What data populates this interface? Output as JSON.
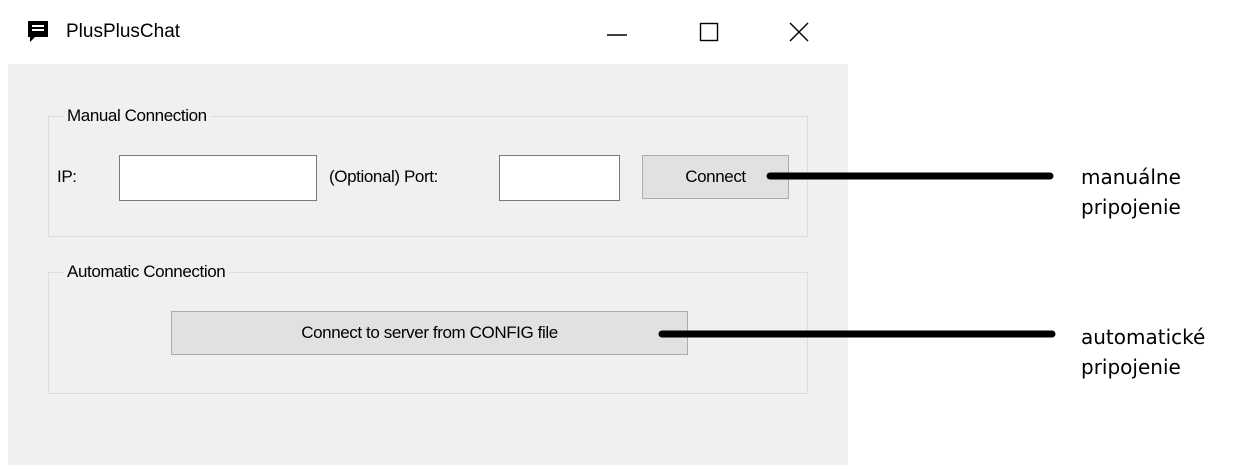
{
  "window": {
    "title": "PlusPlusChat",
    "icon": "chat-bubble-icon",
    "controls": {
      "minimize_icon": "minimize-icon",
      "maximize_icon": "maximize-icon",
      "close_icon": "close-icon"
    }
  },
  "manual_connection": {
    "legend": "Manual Connection",
    "ip_label": "IP:",
    "ip_value": "",
    "port_label": "(Optional) Port:",
    "port_value": "",
    "connect_label": "Connect"
  },
  "automatic_connection": {
    "legend": "Automatic Connection",
    "config_button_label": "Connect to server from CONFIG file"
  },
  "annotations": {
    "manual": {
      "line1": "manuálne",
      "line2": "pripojenie"
    },
    "automatic": {
      "line1": "automatické",
      "line2": "pripojenie"
    }
  },
  "colors": {
    "window_bg": "#f0f0f0",
    "button_bg": "#e1e1e1",
    "button_border": "#adadad",
    "group_border": "#dcdcdc"
  }
}
